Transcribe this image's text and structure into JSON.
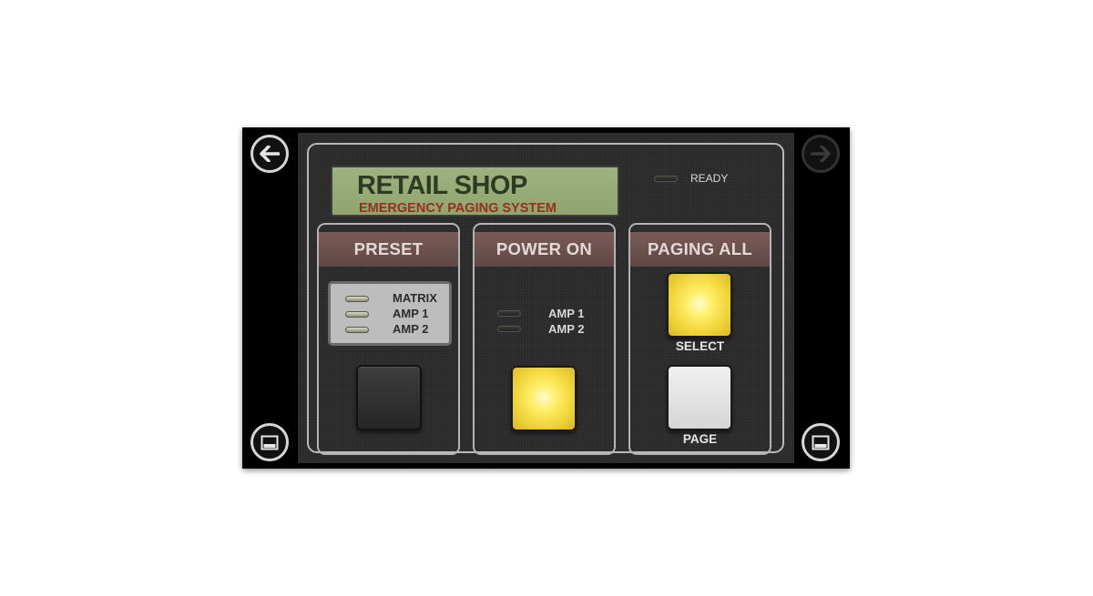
{
  "lcd": {
    "title": "RETAIL SHOP",
    "subtitle": "EMERGENCY PAGING SYSTEM"
  },
  "status": {
    "ready_label": "READY",
    "ready_on": false
  },
  "panels": [
    {
      "heading": "PRESET",
      "indicators": [
        {
          "label": "MATRIX",
          "on": false
        },
        {
          "label": "AMP 1",
          "on": false
        },
        {
          "label": "AMP 2",
          "on": false
        }
      ],
      "button_state": "off"
    },
    {
      "heading": "POWER ON",
      "indicators": [
        {
          "label": "AMP 1",
          "on": false
        },
        {
          "label": "AMP 2",
          "on": false
        }
      ],
      "button_state": "lit-yellow"
    },
    {
      "heading": "PAGING ALL",
      "select_label": "SELECT",
      "select_state": "lit-yellow",
      "page_label": "PAGE",
      "page_state": "white"
    }
  ],
  "nav": {
    "back_icon": "arrow-left-icon",
    "forward_icon": "arrow-right-icon",
    "left_bottom_icon": "panel-minimize-icon",
    "right_bottom_icon": "panel-minimize-icon"
  },
  "colors": {
    "lcd_background": "#9fb27e",
    "lcd_title": "#2f3a22",
    "lcd_subtitle": "#9a2e1c",
    "panel_header": "#6e524e",
    "button_yellow": "#ffef6a"
  }
}
